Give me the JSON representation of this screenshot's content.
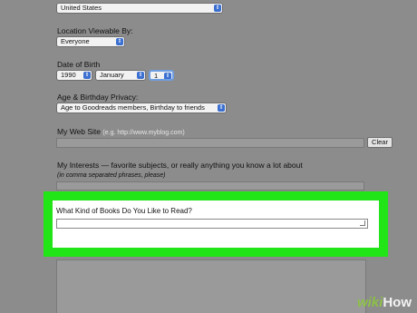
{
  "country": {
    "selected": "United States"
  },
  "location_viewable": {
    "label": "Location Viewable By:",
    "selected": "Everyone"
  },
  "date_of_birth": {
    "label": "Date of Birth",
    "year": "1990",
    "month": "January",
    "day": "1"
  },
  "age_birthday_privacy": {
    "label": "Age & Birthday Privacy:",
    "selected": "Age to Goodreads members, Birthday to friends"
  },
  "website": {
    "label": "My Web Site",
    "hint": "(e.g. http://www.myblog.com)",
    "clear_button": "Clear",
    "value": ""
  },
  "interests": {
    "label": "My Interests — favorite subjects, or really anything you know a lot about",
    "hint": "(in comma separated phrases, please)",
    "value": ""
  },
  "books": {
    "label": "What Kind of Books Do You Like to Read?",
    "value": ""
  },
  "watermark": {
    "brand_a": "wiki",
    "brand_b": "How"
  }
}
